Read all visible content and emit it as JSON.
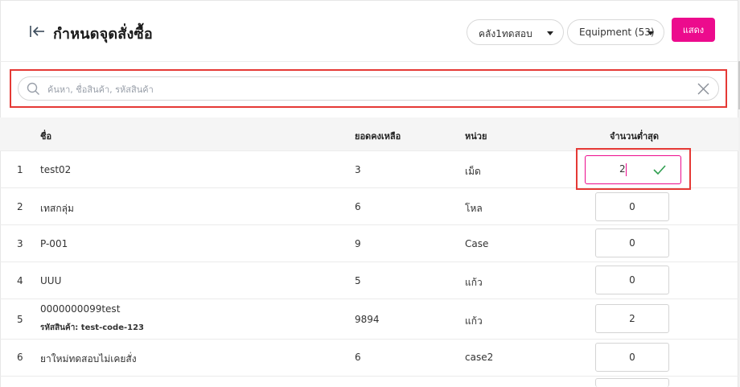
{
  "header": {
    "title": "กำหนดจุดสั่งซื้อ",
    "warehouse_select": "คลัง1ทดสอบ",
    "category_select": "Equipment (53)",
    "show_button": "แสดง"
  },
  "search": {
    "placeholder": "ค้นหา, ชื่อสินค้า, รหัสสินค้า",
    "value": ""
  },
  "table": {
    "columns": [
      "ชื่อ",
      "ยอดคงเหลือ",
      "หน่วย",
      "จำนวนต่ำสุด"
    ],
    "rows": [
      {
        "no": "1",
        "name": "test02",
        "sub": "",
        "balance": "3",
        "unit": "เม็ด",
        "min_qty": "2"
      },
      {
        "no": "2",
        "name": "เทสกลุ่ม",
        "sub": "",
        "balance": "6",
        "unit": "โหล",
        "min_qty": "0"
      },
      {
        "no": "3",
        "name": "P-001",
        "sub": "",
        "balance": "9",
        "unit": "Case",
        "min_qty": "0"
      },
      {
        "no": "4",
        "name": "UUU",
        "sub": "",
        "balance": "5",
        "unit": "แก้ว",
        "min_qty": "0"
      },
      {
        "no": "5",
        "name": "0000000099test",
        "sub": "รหัสสินค้า: test-code-123",
        "balance": "9894",
        "unit": "แก้ว",
        "min_qty": "2"
      },
      {
        "no": "6",
        "name": "ยาใหม่ทดสอบไม่เคยสั่ง",
        "sub": "",
        "balance": "6",
        "unit": "case2",
        "min_qty": "0"
      }
    ]
  },
  "colors": {
    "accent": "#ec0b8d",
    "highlight": "#e53935",
    "check": "#2e9e4f"
  },
  "icons": [
    "back-arrow-icon",
    "chevron-down-icon",
    "search-icon",
    "close-icon",
    "check-icon"
  ]
}
